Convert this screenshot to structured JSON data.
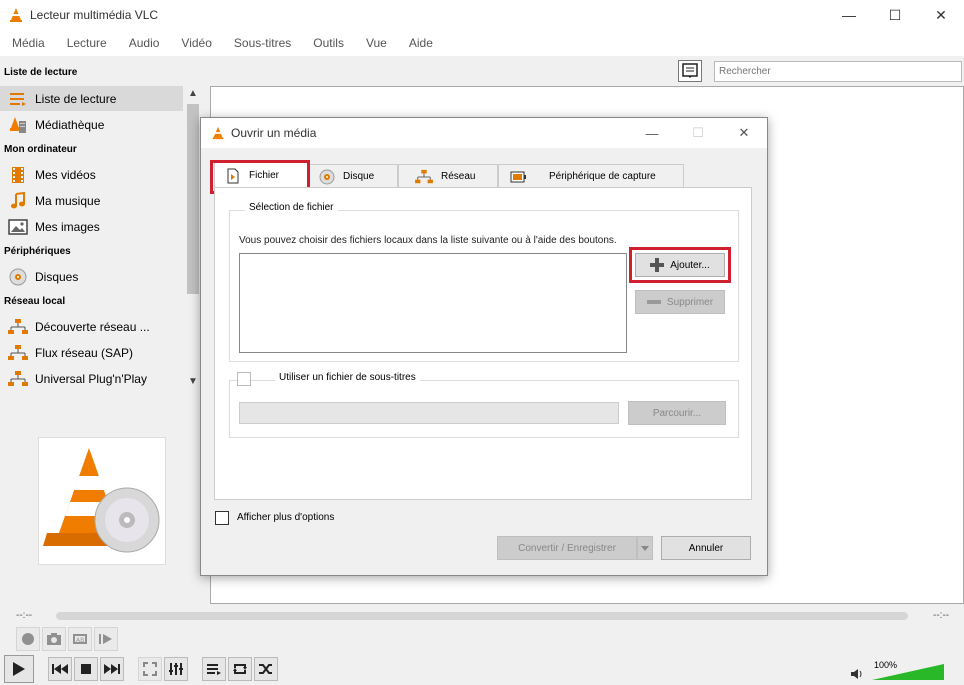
{
  "window": {
    "title": "Lecteur multimédia VLC",
    "minimize": "—",
    "maximize": "☐",
    "close": "✕"
  },
  "menu": [
    "Média",
    "Lecture",
    "Audio",
    "Vidéo",
    "Sous-titres",
    "Outils",
    "Vue",
    "Aide"
  ],
  "sidebar": {
    "headers": [
      "Liste de lecture",
      "Mon ordinateur",
      "Périphériques",
      "Réseau local"
    ],
    "items": [
      {
        "label": "Liste de lecture",
        "icon": "playlist-icon"
      },
      {
        "label": "Médiathèque",
        "icon": "media-library-icon"
      },
      {
        "label": "Mes vidéos",
        "icon": "film-icon"
      },
      {
        "label": "Ma musique",
        "icon": "music-note-icon"
      },
      {
        "label": "Mes images",
        "icon": "image-icon"
      },
      {
        "label": "Disques",
        "icon": "disc-icon"
      },
      {
        "label": "Découverte réseau ...",
        "icon": "network-icon"
      },
      {
        "label": "Flux réseau (SAP)",
        "icon": "network-icon"
      },
      {
        "label": "Universal Plug'n'Play",
        "icon": "network-icon"
      }
    ]
  },
  "search": {
    "placeholder": "Rechercher"
  },
  "player": {
    "time_elapsed": "--:--",
    "time_total": "--:--",
    "volume": "100%",
    "volume_fraction": 1.0
  },
  "dialog": {
    "title": "Ouvrir un média",
    "tabs": [
      "Fichier",
      "Disque",
      "Réseau",
      "Périphérique de capture"
    ],
    "file_selection_legend": "Sélection de fichier",
    "description": "Vous pouvez choisir des fichiers locaux dans la liste suivante ou à l'aide des boutons.",
    "add_label": "Ajouter...",
    "remove_label": "Supprimer",
    "subtitle_label": "Utiliser un fichier de sous-titres",
    "browse_label": "Parcourir...",
    "more_options_label": "Afficher plus d'options",
    "convert_label": "Convertir / Enregistrer",
    "cancel_label": "Annuler"
  },
  "colors": {
    "highlight": "#d01f2f",
    "vlc_orange": "#f07d00",
    "volume_green": "#28b828"
  }
}
